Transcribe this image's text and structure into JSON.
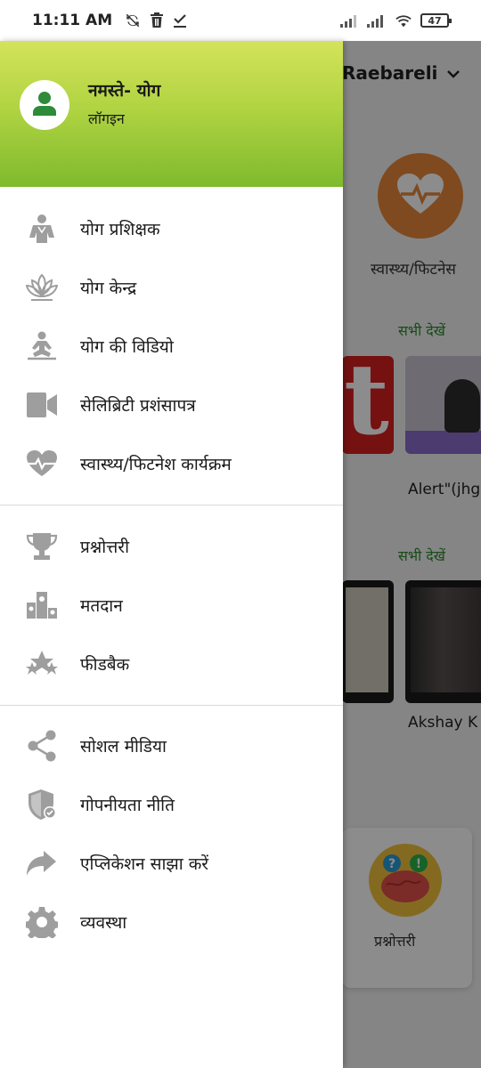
{
  "status_bar": {
    "time": "11:11 AM",
    "battery": "47"
  },
  "drawer": {
    "greeting": "नमस्ते- योग",
    "login_label": "लॉगइन",
    "section1": [
      {
        "label": "योग प्रशिक्षक",
        "icon": "trainer-icon"
      },
      {
        "label": "योग केन्द्र",
        "icon": "lotus-icon"
      },
      {
        "label": "योग की विडियो",
        "icon": "meditation-icon"
      },
      {
        "label": "सेलिब्रिटी प्रशंसापत्र",
        "icon": "video-camera-icon"
      },
      {
        "label": "स्वास्थ्य/फिटनेश कार्यक्रम",
        "icon": "heartbeat-icon"
      }
    ],
    "section2": [
      {
        "label": "प्रश्नोत्तरी",
        "icon": "trophy-icon"
      },
      {
        "label": "मतदान",
        "icon": "poll-icon"
      },
      {
        "label": "फीडबैक",
        "icon": "stars-icon"
      }
    ],
    "section3": [
      {
        "label": "सोशल मीडिया",
        "icon": "share-icon"
      },
      {
        "label": "गोपनीयता नीति",
        "icon": "shield-check-icon"
      },
      {
        "label": "एप्लिकेशन साझा करें",
        "icon": "forward-arrow-icon"
      },
      {
        "label": "व्यवस्था",
        "icon": "gear-icon"
      }
    ]
  },
  "background": {
    "location": "Raebareli",
    "health_label": "स्वास्थ्य/फिटनेस",
    "see_all_1": "सभी देखें",
    "video_title_1": "Alert\"(jhg",
    "see_all_2": "सभी देखें",
    "video_title_2": "Akshay K",
    "quiz_label": "प्रश्नोत्तरी"
  },
  "colors": {
    "header_gradient_top": "#d4e35b",
    "header_gradient_bottom": "#7fba2d",
    "avatar_icon": "#2e8b3a",
    "icon_gray": "#9e9e9e",
    "see_all_green": "#2e8b2e",
    "health_orange": "#e8883a"
  }
}
